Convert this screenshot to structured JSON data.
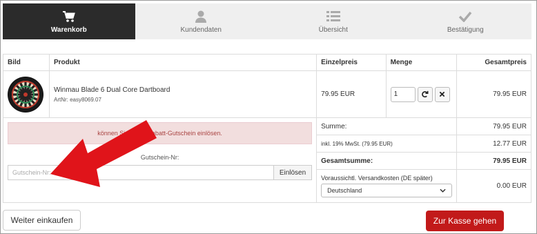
{
  "steps": [
    {
      "label": "Warenkorb",
      "icon": "cart-icon",
      "active": true
    },
    {
      "label": "Kundendaten",
      "icon": "user-icon",
      "active": false
    },
    {
      "label": "Übersicht",
      "icon": "list-icon",
      "active": false
    },
    {
      "label": "Bestätigung",
      "icon": "check-icon",
      "active": false
    }
  ],
  "table": {
    "headers": {
      "image": "Bild",
      "product": "Produkt",
      "unit_price": "Einzelpreis",
      "quantity": "Menge",
      "total": "Gesamtpreis"
    },
    "item": {
      "name": "Winmau Blade 6 Dual Core Dartboard",
      "art_nr": "ArtNr: easy8069.07",
      "unit_price": "79.95 EUR",
      "quantity": "1",
      "total": "79.95 EUR"
    }
  },
  "coupon": {
    "alert": "können Sie einen Rabatt-Gutschein einlösen.",
    "label": "Gutschein-Nr:",
    "placeholder": "Gutschein-Nr:",
    "button": "Einlösen"
  },
  "summary": {
    "sum_label": "Summe:",
    "sum_value": "79.95 EUR",
    "vat_label": "inkl. 19% MwSt. (79.95 EUR)",
    "vat_value": "12.77 EUR",
    "total_label": "Gesamtsumme:",
    "total_value": "79.95 EUR",
    "shipping_label": "Voraussichtl. Versandkosten (DE später)",
    "shipping_country": "Deutschland",
    "shipping_value": "0.00 EUR"
  },
  "buttons": {
    "back": "Weiter einkaufen",
    "checkout": "Zur Kasse gehen"
  },
  "colors": {
    "active_step": "#2b2b2b",
    "checkout": "#c21a1a",
    "alert_bg": "#f2dede",
    "arrow": "#e0141a"
  }
}
